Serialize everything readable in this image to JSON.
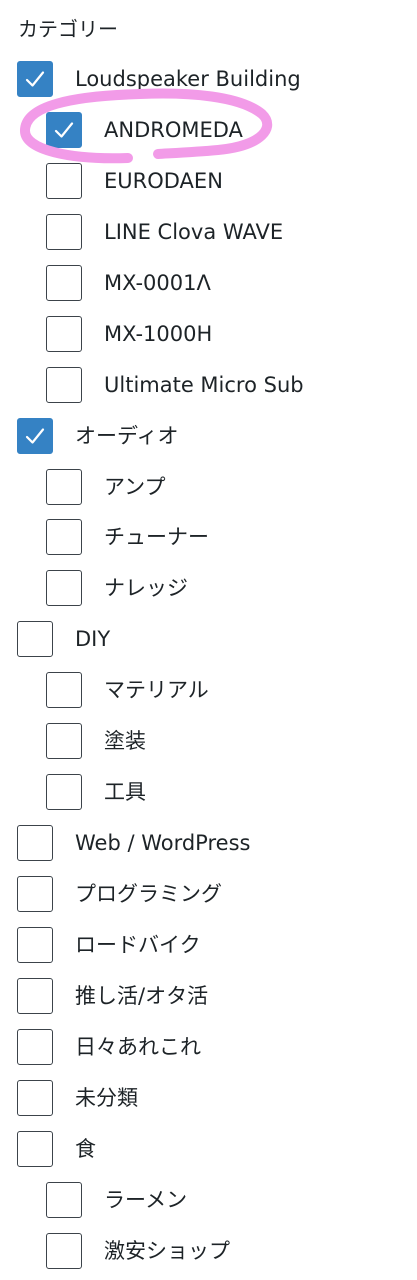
{
  "panel": {
    "title": "カテゴリー",
    "categories": [
      {
        "label": "Loudspeaker Building",
        "checked": true,
        "level": 0
      },
      {
        "label": "ANDROMEDA",
        "checked": true,
        "level": 1
      },
      {
        "label": "EURODAEN",
        "checked": false,
        "level": 1
      },
      {
        "label": "LINE Clova WAVE",
        "checked": false,
        "level": 1
      },
      {
        "label": "MX-0001Λ",
        "checked": false,
        "level": 1
      },
      {
        "label": "MX-1000H",
        "checked": false,
        "level": 1
      },
      {
        "label": "Ultimate Micro Sub",
        "checked": false,
        "level": 1
      },
      {
        "label": "オーディオ",
        "checked": true,
        "level": 0
      },
      {
        "label": "アンプ",
        "checked": false,
        "level": 1
      },
      {
        "label": "チューナー",
        "checked": false,
        "level": 1
      },
      {
        "label": "ナレッジ",
        "checked": false,
        "level": 1
      },
      {
        "label": "DIY",
        "checked": false,
        "level": 0
      },
      {
        "label": "マテリアル",
        "checked": false,
        "level": 1
      },
      {
        "label": "塗装",
        "checked": false,
        "level": 1
      },
      {
        "label": "工具",
        "checked": false,
        "level": 1
      },
      {
        "label": "Web / WordPress",
        "checked": false,
        "level": 0
      },
      {
        "label": "プログラミング",
        "checked": false,
        "level": 0
      },
      {
        "label": "ロードバイク",
        "checked": false,
        "level": 0
      },
      {
        "label": "推し活/オタ活",
        "checked": false,
        "level": 0
      },
      {
        "label": "日々あれこれ",
        "checked": false,
        "level": 0
      },
      {
        "label": "未分類",
        "checked": false,
        "level": 0
      },
      {
        "label": "食",
        "checked": false,
        "level": 0
      },
      {
        "label": "ラーメン",
        "checked": false,
        "level": 1
      },
      {
        "label": "激安ショップ",
        "checked": false,
        "level": 1
      }
    ]
  },
  "colors": {
    "checkbox_checked": "#3582c4",
    "checkbox_border": "#3c434a",
    "text": "#1d2327",
    "highlight_marker": "#f29be8"
  },
  "icons": {
    "checkmark": "checkmark-icon",
    "highlight": "pink-marker-circle"
  }
}
